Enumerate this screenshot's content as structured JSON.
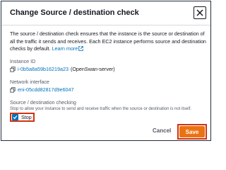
{
  "dialog": {
    "title": "Change Source / destination check",
    "description": "The source / destination check ensures that the instance is the source or destination of all the traffic it sends and receives. Each EC2 instance performs source and destination checks by default.",
    "learn_more": "Learn more"
  },
  "instance": {
    "label": "Instance ID",
    "id": "i-0b5a8a59b16219a23",
    "name": "(OpenSwan-server)"
  },
  "network": {
    "label": "Network interface",
    "id": "eni-05cdd82817d9e6047"
  },
  "check": {
    "label": "Source / destination checking",
    "hint": "Stop to allow your instance to send and receive traffic when the source or destination is not itself.",
    "option": "Stop",
    "checked": true
  },
  "footer": {
    "cancel": "Cancel",
    "save": "Save"
  },
  "colors": {
    "link": "#0073bb",
    "primary_button": "#ec7211",
    "highlight": "#d13212"
  }
}
